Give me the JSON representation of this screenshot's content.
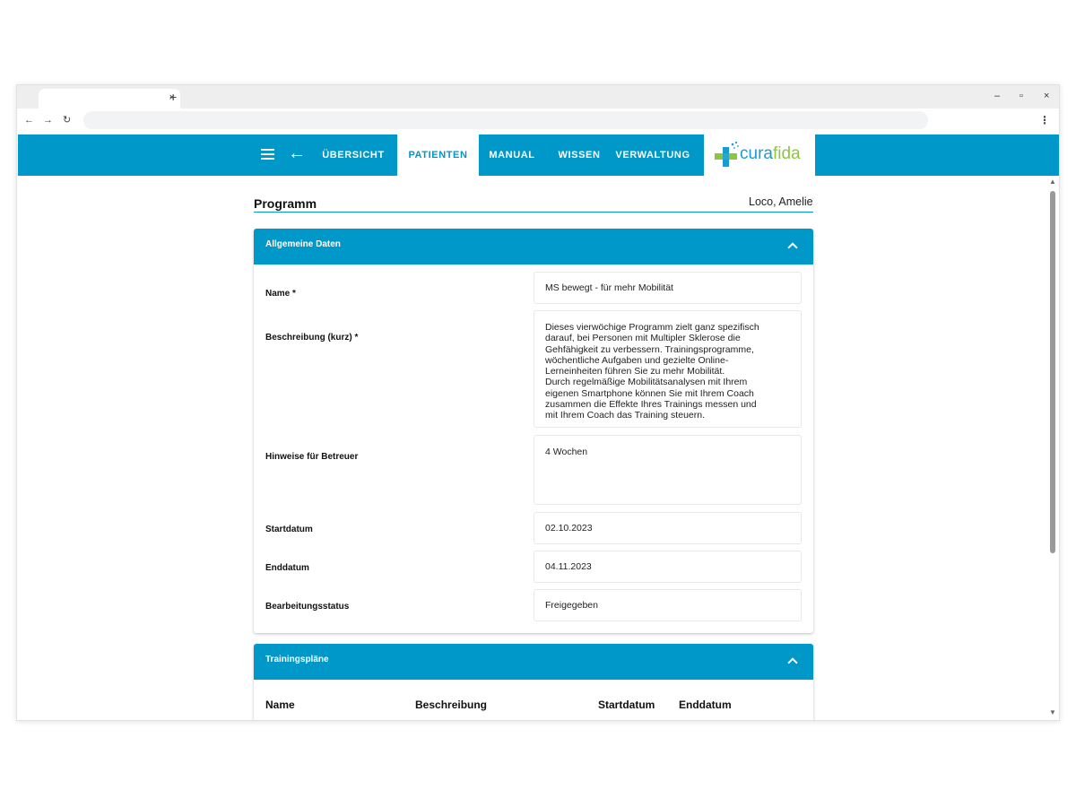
{
  "browser": {
    "tab_close": "×",
    "new_tab": "+",
    "minimize": "–",
    "restore": "▫",
    "close": "×",
    "back": "←",
    "forward": "→",
    "reload": "↻",
    "menu": "⋮"
  },
  "header": {
    "nav": [
      "ÜBERSICHT",
      "PATIENTEN",
      "MANUAL",
      "WISSEN",
      "VERWALTUNG"
    ],
    "active_nav": "PATIENTEN",
    "logo_part1": "cura",
    "logo_part2": "fida",
    "colors": {
      "primary": "#0097c9",
      "logo_blue": "#1a9bd1",
      "logo_green": "#8cc63f"
    }
  },
  "page": {
    "title": "Programm",
    "patient": "Loco, Amelie"
  },
  "general": {
    "title": "Allgemeine Daten",
    "fields": [
      {
        "label": "Name *",
        "value": "MS bewegt - für mehr Mobilität"
      },
      {
        "label": "Beschreibung (kurz) *",
        "value": "Dieses vierwöchige Programm zielt ganz spezifisch\ndarauf, bei Personen mit Multipler Sklerose die\nGehfähigkeit zu verbessern. Trainingsprogramme,\nwöchentliche Aufgaben und gezielte Online-\nLerneinheiten führen Sie zu mehr Mobilität.\nDurch regelmäßige Mobilitätsanalysen mit Ihrem\neigenen Smartphone können Sie mit Ihrem Coach\nzusammen die Effekte Ihres Trainings messen und\nmit Ihrem Coach das Training steuern."
      },
      {
        "label": "Hinweise für Betreuer",
        "value": "4 Wochen"
      },
      {
        "label": "Startdatum",
        "value": "02.10.2023"
      },
      {
        "label": "Enddatum",
        "value": "04.11.2023"
      },
      {
        "label": "Bearbeitungsstatus",
        "value": "Freigegeben"
      }
    ]
  },
  "training": {
    "title": "Trainingspläne",
    "columns": [
      "Name",
      "Beschreibung",
      "Startdatum",
      "Enddatum"
    ]
  }
}
